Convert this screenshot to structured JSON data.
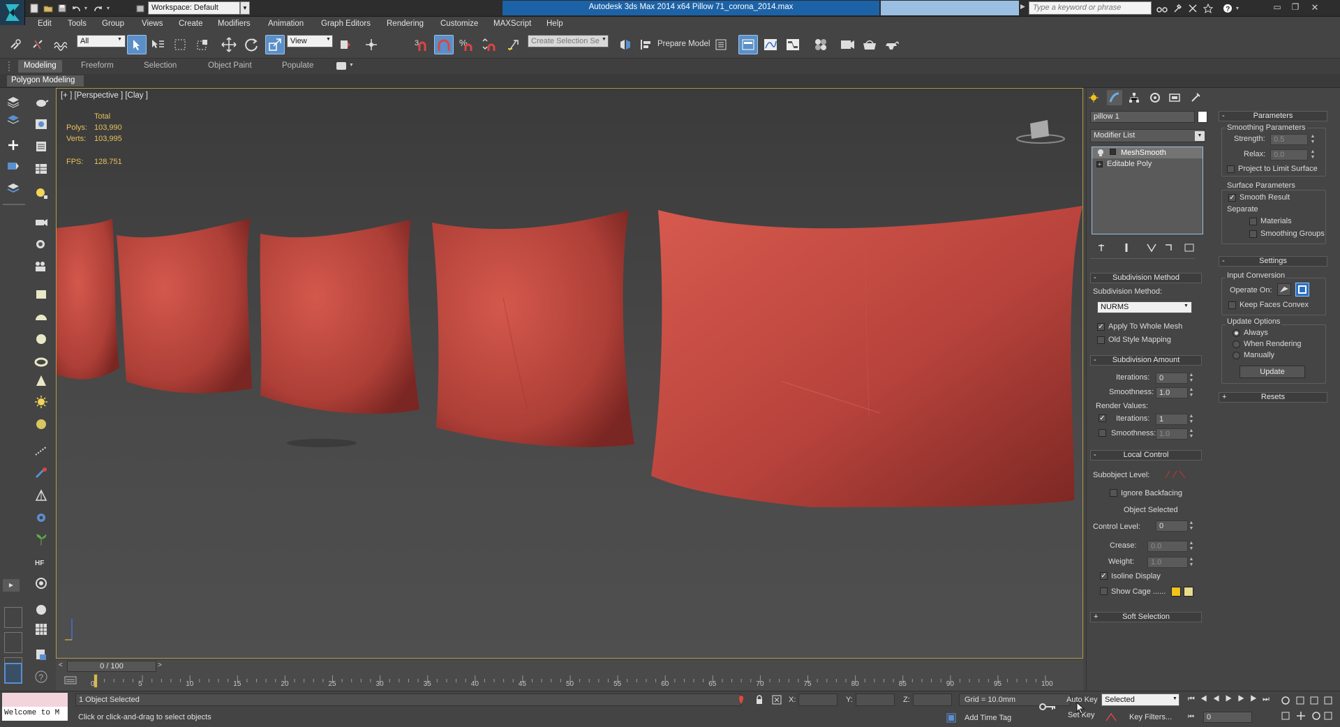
{
  "window": {
    "workspace": "Workspace: Default",
    "title": "Autodesk 3ds Max  2014 x64      Pillow 71_corona_2014.max",
    "search_placeholder": "Type a keyword or phrase"
  },
  "menu": [
    "Edit",
    "Tools",
    "Group",
    "Views",
    "Create",
    "Modifiers",
    "Animation",
    "Graph Editors",
    "Rendering",
    "Customize",
    "MAXScript",
    "Help"
  ],
  "toolbar": {
    "filter": "All",
    "ref_coord": "View",
    "selection_set": "Create Selection Se",
    "prepare_model": "Prepare Model"
  },
  "ribbon": {
    "tabs": [
      "Modeling",
      "Freeform",
      "Selection",
      "Object Paint",
      "Populate"
    ],
    "active": "Modeling",
    "panel_label": "Polygon Modeling"
  },
  "viewport": {
    "label": "[+ ] [Perspective ] [Clay ]",
    "stats": {
      "total": "Total",
      "polys_label": "Polys:",
      "polys": "103,990",
      "verts_label": "Verts:",
      "verts": "103,995",
      "fps_label": "FPS:",
      "fps": "128.751"
    },
    "pillow_color": "#b8433c"
  },
  "timeline": {
    "slider": "0 / 100",
    "ticks": [
      "0",
      "5",
      "10",
      "15",
      "20",
      "25",
      "30",
      "35",
      "40",
      "45",
      "50",
      "55",
      "60",
      "65",
      "70",
      "75",
      "80",
      "85",
      "90",
      "95",
      "100"
    ]
  },
  "status": {
    "selected": "1 Object Selected",
    "prompt": "Click or click-and-drag to select objects",
    "welcome": "Welcome to M",
    "x_label": "X:",
    "y_label": "Y:",
    "z_label": "Z:",
    "grid": "Grid = 10.0mm",
    "add_time_tag": "Add Time Tag",
    "auto_key": "Auto Key",
    "set_key": "Set Key",
    "key_mode": "Selected",
    "key_filters": "Key Filters...",
    "frame": "0"
  },
  "command_panel": {
    "object_name": "pillow 1",
    "modifier_list": "Modifier List",
    "stack": [
      "MeshSmooth",
      "Editable Poly"
    ],
    "subdivision_method": {
      "title": "Subdivision Method",
      "method_label": "Subdivision Method:",
      "method": "NURMS",
      "apply_whole_mesh": "Apply To Whole Mesh",
      "old_style_mapping": "Old Style Mapping"
    },
    "subdivision_amount": {
      "title": "Subdivision Amount",
      "iterations_label": "Iterations:",
      "iterations": "0",
      "smoothness_label": "Smoothness:",
      "smoothness": "1.0",
      "render_values": "Render Values:",
      "r_iterations_label": "Iterations:",
      "r_iterations": "1",
      "r_smoothness_label": "Smoothness:",
      "r_smoothness": "1.0"
    },
    "local_control": {
      "title": "Local Control",
      "subobject_level": "Subobject Level:",
      "ignore_backfacing": "Ignore Backfacing",
      "object_selected": "Object Selected",
      "control_level_label": "Control Level:",
      "control_level": "0",
      "crease_label": "Crease:",
      "crease": "0.0",
      "weight_label": "Weight:",
      "weight": "1.0",
      "isoline_display": "Isoline Display",
      "show_cage": "Show Cage ......",
      "cage_color_1": "#f2c21b",
      "cage_color_2": "#e9dc8c"
    },
    "soft_selection": "Soft Selection",
    "parameters": {
      "title": "Parameters",
      "smoothing_params": "Smoothing Parameters",
      "strength_label": "Strength:",
      "strength": "0.5",
      "relax_label": "Relax:",
      "relax": "0.0",
      "project_limit": "Project to Limit Surface",
      "surface_params": "Surface Parameters",
      "smooth_result": "Smooth Result",
      "separate": "Separate",
      "materials": "Materials",
      "smoothing_groups": "Smoothing Groups"
    },
    "settings": {
      "title": "Settings",
      "input_conversion": "Input Conversion",
      "operate_on": "Operate On:",
      "keep_faces_convex": "Keep Faces Convex",
      "update_options": "Update Options",
      "always": "Always",
      "when_rendering": "When Rendering",
      "manually": "Manually",
      "update": "Update"
    },
    "resets": "Resets"
  }
}
